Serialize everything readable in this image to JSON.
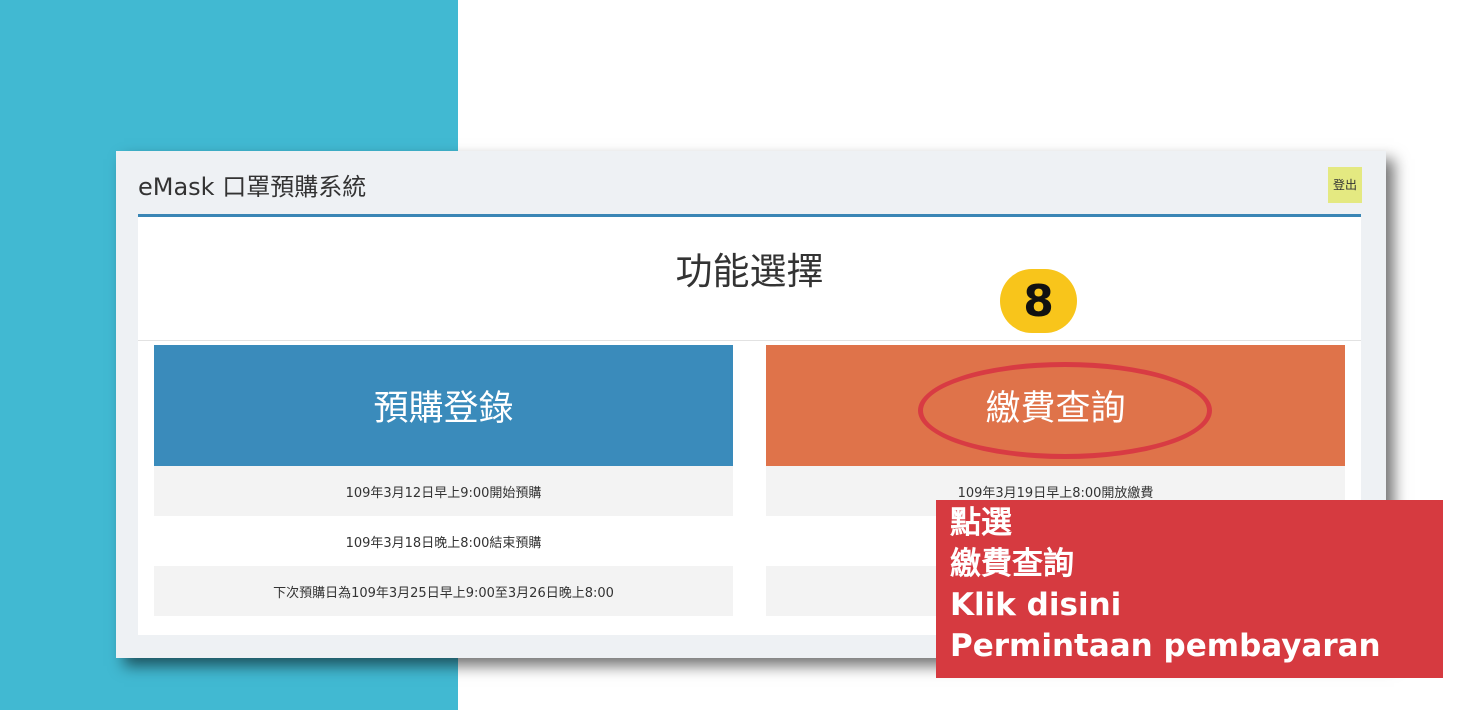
{
  "app": {
    "title": "eMask 口罩預購系統",
    "logout_label": "登出"
  },
  "panel": {
    "heading": "功能選擇"
  },
  "cards": [
    {
      "title": "預購登錄",
      "color": "#3a8bbb",
      "lines": [
        "109年3月12日早上9:00開始預購",
        "109年3月18日晚上8:00結束預購",
        "下次預購日為109年3月25日早上9:00至3月26日晚上8:00"
      ]
    },
    {
      "title": "繳費查詢",
      "color": "#df734a",
      "lines": [
        "109年3月19日早上8:00開放繳費"
      ]
    }
  ],
  "annotation": {
    "step_number": "8",
    "step_badge_color": "#f8c51b",
    "highlight_color": "#d83b43",
    "callout_lines": [
      "點選",
      "繳費查詢",
      "Klik disini",
      "Permintaan pembayaran"
    ]
  }
}
